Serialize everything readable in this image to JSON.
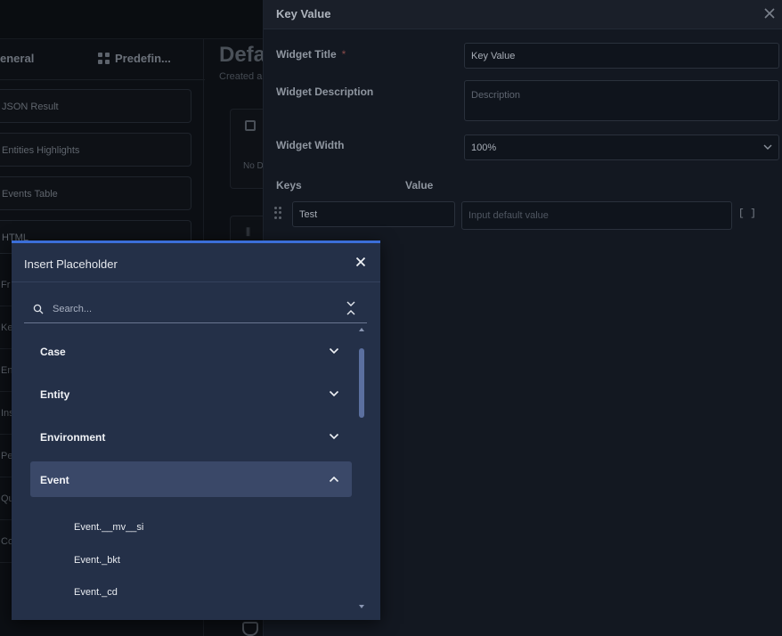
{
  "background": {
    "tabs": {
      "general": "eneral",
      "predefined": "Predefin..."
    },
    "list_items": [
      "JSON Result",
      "Entities Highlights",
      "Events Table",
      "HTML"
    ],
    "lower_items": [
      "Fr",
      "Ke",
      "En",
      "Ins",
      "Pe",
      "Qu",
      "Co"
    ],
    "main_title": "Defa",
    "main_subtitle": "Created a",
    "card_text": "No D"
  },
  "side_panel": {
    "title": "Key Value",
    "widget_title_label": "Widget Title",
    "required_mark": "*",
    "widget_title_value": "Key Value",
    "widget_description_label": "Widget Description",
    "widget_description_placeholder": "Description",
    "widget_width_label": "Widget Width",
    "widget_width_value": "100%",
    "keys_label": "Keys",
    "value_label": "Value",
    "key_row": {
      "key": "Test",
      "value_placeholder": "Input default value",
      "bracket_glyph": "[ ]"
    }
  },
  "modal": {
    "title": "Insert Placeholder",
    "search_placeholder": "Search...",
    "categories": [
      {
        "label": "Case",
        "expanded": false
      },
      {
        "label": "Entity",
        "expanded": false
      },
      {
        "label": "Environment",
        "expanded": false
      },
      {
        "label": "Event",
        "expanded": true
      }
    ],
    "event_children": [
      "Event.__mv__si",
      "Event._bkt",
      "Event._cd"
    ]
  },
  "colors": {
    "modal_bg": "#243048",
    "modal_accent": "#3b6ed8",
    "active_row": "#3a4868",
    "panel_bg": "#131821"
  }
}
